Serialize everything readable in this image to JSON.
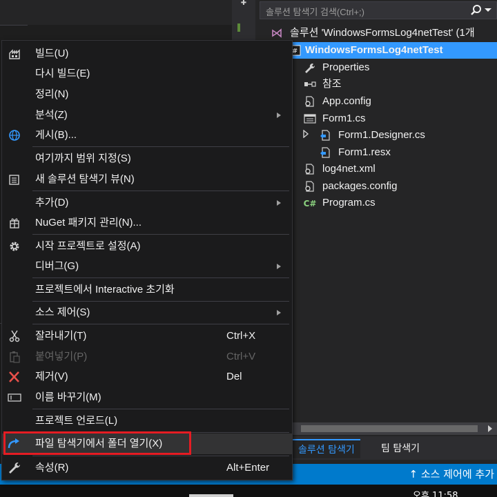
{
  "colors": {
    "accent": "#3399ff",
    "status_bar": "#007acc",
    "highlight_border": "#e51c23",
    "delete_icon": "#e8504a",
    "csharp_icon": "#8bd27f"
  },
  "solution_explorer": {
    "search_placeholder": "솔루션 탐색기 검색(Ctrl+;)",
    "search_icon": "search-icon",
    "tree": [
      {
        "label": "솔루션 'WindowsFormsLog4netTest' (1개",
        "icon": "solution-icon"
      },
      {
        "label": "WindowsFormsLog4netTest",
        "icon": "csharp-project-icon",
        "selected": true
      },
      {
        "label": "Properties",
        "icon": "wrench-icon"
      },
      {
        "label": "참조",
        "icon": "references-icon"
      },
      {
        "label": "App.config",
        "icon": "config-file-icon"
      },
      {
        "label": "Form1.cs",
        "icon": "form-icon"
      },
      {
        "label": "Form1.Designer.cs",
        "icon": "csharp-file-icon"
      },
      {
        "label": "Form1.resx",
        "icon": "resx-file-icon"
      },
      {
        "label": "log4net.xml",
        "icon": "xml-file-icon"
      },
      {
        "label": "packages.config",
        "icon": "config-file-icon"
      },
      {
        "label": "Program.cs",
        "icon": "csharp-file-icon"
      }
    ],
    "tabs": [
      {
        "label": "솔루션 탐색기",
        "active": true
      },
      {
        "label": "팀 탐색기",
        "active": false
      }
    ]
  },
  "status_bar": {
    "source_control": "↑ 소스 제어에 추가"
  },
  "taskbar": {
    "time": "오후 11:58"
  },
  "context_menu": {
    "items": [
      {
        "label": "빌드(U)",
        "icon": "build-icon"
      },
      {
        "label": "다시 빌드(E)"
      },
      {
        "label": "정리(N)"
      },
      {
        "label": "분석(Z)",
        "submenu": true
      },
      {
        "label": "게시(B)...",
        "icon": "globe-icon"
      },
      {
        "label": "여기까지 범위 지정(S)"
      },
      {
        "label": "새 솔루션 탐색기 뷰(N)",
        "icon": "new-view-icon"
      },
      {
        "label": "추가(D)",
        "submenu": true
      },
      {
        "label": "NuGet 패키지 관리(N)...",
        "icon": "nuget-icon"
      },
      {
        "label": "시작 프로젝트로 설정(A)",
        "icon": "gear-icon"
      },
      {
        "label": "디버그(G)",
        "submenu": true
      },
      {
        "label": "프로젝트에서 Interactive 초기화"
      },
      {
        "label": "소스 제어(S)",
        "submenu": true
      },
      {
        "label": "잘라내기(T)",
        "shortcut": "Ctrl+X",
        "icon": "scissors-icon"
      },
      {
        "label": "붙여넣기(P)",
        "shortcut": "Ctrl+V",
        "icon": "paste-icon",
        "disabled": true
      },
      {
        "label": "제거(V)",
        "shortcut": "Del",
        "icon": "close-icon"
      },
      {
        "label": "이름 바꾸기(M)",
        "icon": "rename-icon"
      },
      {
        "label": "프로젝트 언로드(L)"
      },
      {
        "label": "파일 탐색기에서 폴더 열기(X)",
        "icon": "open-folder-arrow-icon",
        "highlighted": true
      },
      {
        "label": "속성(R)",
        "shortcut": "Alt+Enter",
        "icon": "wrench-icon"
      }
    ]
  }
}
